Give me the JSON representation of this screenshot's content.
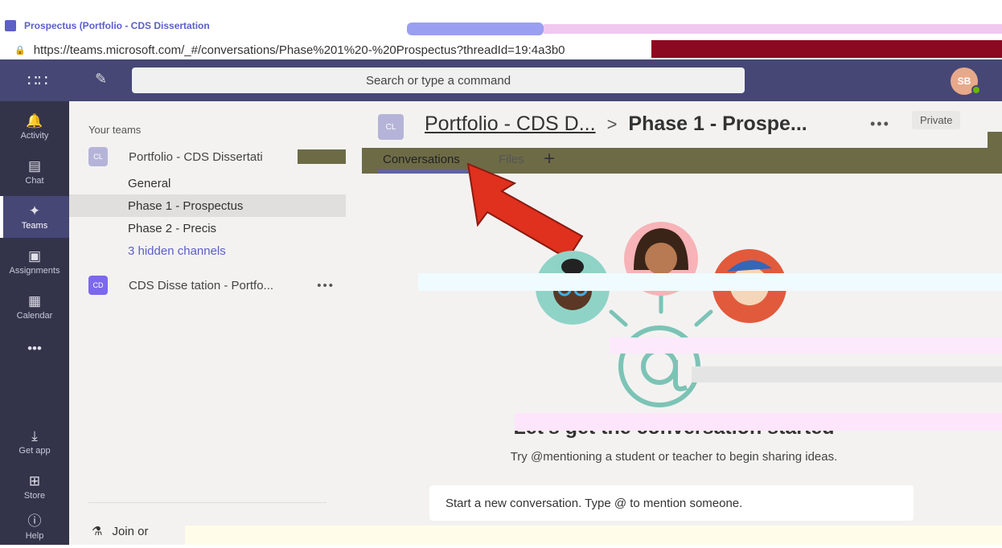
{
  "browser": {
    "tab_title": "Prospectus (Portfolio - CDS Dissertation",
    "url": "https://teams.microsoft.com/_#/conversations/Phase%201%20-%20Prospectus?threadId=19:4a3b0"
  },
  "header": {
    "search_placeholder": "Search or type a command",
    "avatar_initials": "SB"
  },
  "rail": [
    {
      "label": "Activity",
      "icon": "bell-icon"
    },
    {
      "label": "Chat",
      "icon": "chat-icon"
    },
    {
      "label": "Teams",
      "icon": "teams-icon"
    },
    {
      "label": "Assignments",
      "icon": "assignments-icon"
    },
    {
      "label": "Calendar",
      "icon": "calendar-icon"
    }
  ],
  "rail_bottom": [
    {
      "label": "Get app",
      "icon": "download-icon"
    },
    {
      "label": "Store",
      "icon": "store-icon"
    },
    {
      "label": "Help",
      "icon": "help-icon"
    }
  ],
  "teams_pane": {
    "heading": "Your teams",
    "teams": [
      {
        "badge": "CL",
        "name": "Portfolio - CDS Dissertati",
        "color": "#b5b4d8"
      },
      {
        "badge": "CD",
        "name": "CDS Disse    tation - Portfo...",
        "color": "#7b68ee"
      }
    ],
    "channels": [
      "General",
      "Phase 1 - Prospectus",
      "Phase 2 - Precis",
      "3 hidden channels"
    ],
    "join_label": "Join or"
  },
  "main": {
    "badge": "CL",
    "team_title": "Portfolio - CDS D...",
    "separator": ">",
    "channel_title": "Phase 1 - Prospe...",
    "private_label": "Private",
    "tabs": [
      "Conversations",
      "Files"
    ],
    "empty_title": "Let's get the conversation started",
    "empty_subtitle": "Try @mentioning a student or teacher to begin sharing ideas.",
    "composer_placeholder": "Start a new conversation. Type @ to mention someone."
  }
}
